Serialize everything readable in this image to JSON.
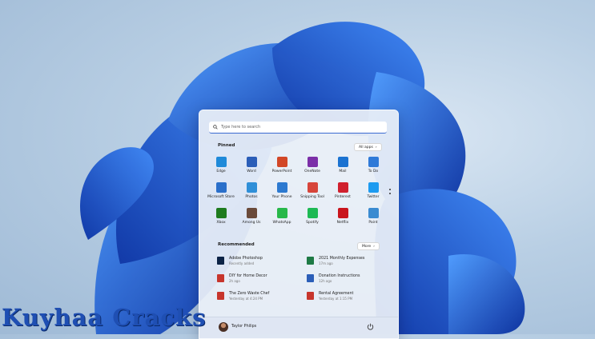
{
  "search": {
    "placeholder": "Type here to search"
  },
  "pinned": {
    "title": "Pinned",
    "all_apps_label": "All apps",
    "apps": [
      {
        "label": "Edge",
        "icon": "edge-icon",
        "color": "#1f8ad9"
      },
      {
        "label": "Word",
        "icon": "word-icon",
        "color": "#2b5eb8"
      },
      {
        "label": "PowerPoint",
        "icon": "powerpoint-icon",
        "color": "#d24726"
      },
      {
        "label": "OneNote",
        "icon": "onenote-icon",
        "color": "#7b2fa8"
      },
      {
        "label": "Mail",
        "icon": "mail-icon",
        "color": "#1c73d1"
      },
      {
        "label": "To Do",
        "icon": "todo-icon",
        "color": "#2f7ad8"
      },
      {
        "label": "Microsoft Store",
        "icon": "store-icon",
        "color": "#2a6fca"
      },
      {
        "label": "Photos",
        "icon": "photos-icon",
        "color": "#2f8fd8"
      },
      {
        "label": "Your Phone",
        "icon": "phone-icon",
        "color": "#2d79d0"
      },
      {
        "label": "Snipping Tool",
        "icon": "snipping-tool-icon",
        "color": "#d7453b"
      },
      {
        "label": "Pinterest",
        "icon": "pinterest-icon",
        "color": "#d0202e"
      },
      {
        "label": "Twitter",
        "icon": "twitter-icon",
        "color": "#1d9bf0"
      },
      {
        "label": "Xbox",
        "icon": "xbox-icon",
        "color": "#1e7b1e"
      },
      {
        "label": "Among Us",
        "icon": "among-us-icon",
        "color": "#6a4a3a"
      },
      {
        "label": "WhatsApp",
        "icon": "whatsapp-icon",
        "color": "#28b84a"
      },
      {
        "label": "Spotify",
        "icon": "spotify-icon",
        "color": "#1db954"
      },
      {
        "label": "Netflix",
        "icon": "netflix-icon",
        "color": "#c9141c"
      },
      {
        "label": "Paint",
        "icon": "paint-icon",
        "color": "#3a8bd1"
      }
    ]
  },
  "recommended": {
    "title": "Recommended",
    "more_label": "More",
    "items": [
      {
        "name": "Adobe Photoshop",
        "sub": "Recently added",
        "icon": "photoshop-icon",
        "color": "#0c2346"
      },
      {
        "name": "2021 Monthly Expenses",
        "sub": "17m ago",
        "icon": "excel-icon",
        "color": "#1e7a45"
      },
      {
        "name": "DIY for Home Decor",
        "sub": "2h ago",
        "icon": "pdf-icon",
        "color": "#c7352c"
      },
      {
        "name": "Donation Instructions",
        "sub": "12h ago",
        "icon": "word-doc-icon",
        "color": "#2b5eb8"
      },
      {
        "name": "The Zero Waste Chef",
        "sub": "Yesterday at 4:24 PM",
        "icon": "pdf-icon",
        "color": "#c7352c"
      },
      {
        "name": "Rental Agreement",
        "sub": "Yesterday at 1:15 PM",
        "icon": "pdf-icon",
        "color": "#c7352c"
      }
    ]
  },
  "user": {
    "name": "Taylor Philips"
  },
  "watermark": "Kuyhaa Cracks",
  "colors": {
    "accent": "#1f5fd6",
    "bloom_dark": "#0b3aa8",
    "bloom_light": "#3d86f0"
  }
}
